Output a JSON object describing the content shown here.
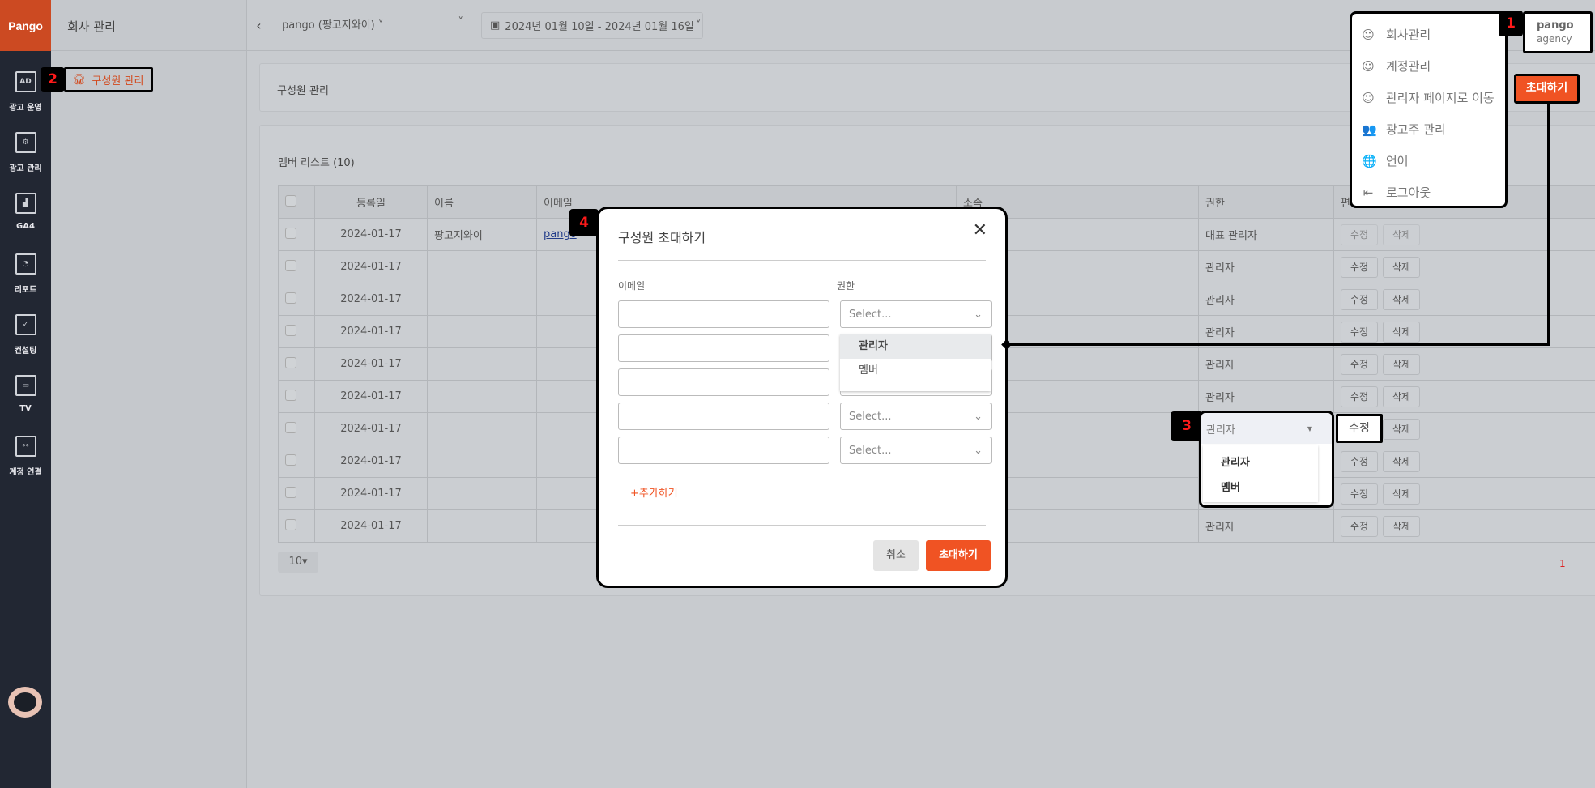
{
  "brand": {
    "logo": "Pango",
    "accent": "#f05323"
  },
  "nav": {
    "items": [
      {
        "label": "광고 운영",
        "icon": "AD"
      },
      {
        "label": "광고 관리",
        "icon": "⚙"
      },
      {
        "label": "GA4",
        "icon": "▟"
      },
      {
        "label": "리포트",
        "icon": "◔"
      },
      {
        "label": "컨설팅",
        "icon": "✓"
      },
      {
        "label": "TV",
        "icon": "▭"
      },
      {
        "label": "계정 연결",
        "icon": "⚯"
      }
    ]
  },
  "subnav": {
    "title": "회사 관리",
    "items": [
      {
        "label": "구성원 관리",
        "icon": "headset"
      }
    ]
  },
  "topbar": {
    "account_select": "pango (팡고지와이)",
    "date_range": "2024년 01월 10일 - 2024년 01월 16일"
  },
  "user": {
    "name": "pango",
    "role": "agency"
  },
  "user_menu": {
    "items": [
      {
        "label": "회사관리",
        "icon": "☺"
      },
      {
        "label": "계정관리",
        "icon": "☺"
      },
      {
        "label": "관리자 페이지로 이동",
        "icon": "☺"
      },
      {
        "label": "광고주 관리",
        "icon": "👥"
      },
      {
        "label": "언어",
        "icon": "🌐"
      },
      {
        "label": "로그아웃",
        "icon": "⇤"
      }
    ]
  },
  "page": {
    "title": "구성원 관리",
    "invite_button": "초대하기"
  },
  "members": {
    "title": "멤버 리스트 (10)",
    "columns": [
      "등록일",
      "이름",
      "이메일",
      "소속",
      "권한",
      "편집"
    ],
    "rows": [
      {
        "date": "2024-01-17",
        "name": "팡고지와이",
        "email": "pango",
        "role": "대표 관리자"
      },
      {
        "date": "2024-01-17",
        "name": "",
        "email": "",
        "role": "관리자"
      },
      {
        "date": "2024-01-17",
        "name": "",
        "email": "",
        "role": "관리자"
      },
      {
        "date": "2024-01-17",
        "name": "",
        "email": "",
        "role": "관리자"
      },
      {
        "date": "2024-01-17",
        "name": "",
        "email": "",
        "role": "관리자"
      },
      {
        "date": "2024-01-17",
        "name": "",
        "email": "",
        "role": "관리자"
      },
      {
        "date": "2024-01-17",
        "name": "",
        "email": "",
        "role": "관리자"
      },
      {
        "date": "2024-01-17",
        "name": "",
        "email": "",
        "role": "관리자"
      },
      {
        "date": "2024-01-17",
        "name": "",
        "email": "",
        "role": "관리자"
      },
      {
        "date": "2024-01-17",
        "name": "",
        "email": "",
        "role": "관리자"
      }
    ],
    "edit_label": "수정",
    "delete_label": "삭제",
    "page_size": "10",
    "current_page": "1"
  },
  "role_dropdown": {
    "value": "관리자",
    "options": [
      "관리자",
      "멤버"
    ]
  },
  "modal": {
    "title": "구성원 초대하기",
    "email_label": "이메일",
    "role_label": "권한",
    "select_placeholder": "Select...",
    "options": [
      "관리자",
      "멤버"
    ],
    "add_label": "+추가하기",
    "cancel": "취소",
    "submit": "초대하기"
  },
  "annotations": [
    "1",
    "2",
    "3",
    "4"
  ]
}
